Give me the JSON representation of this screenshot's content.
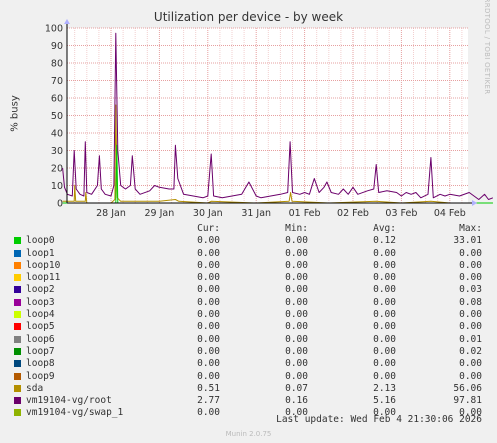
{
  "chart_data": {
    "type": "line",
    "title": "Utilization per device - by week",
    "ylabel": "% busy",
    "ylim": [
      0,
      100
    ],
    "yticks": [
      0,
      10,
      20,
      30,
      40,
      50,
      60,
      70,
      80,
      90,
      100
    ],
    "x_tick_labels": [
      "28 Jan",
      "29 Jan",
      "30 Jan",
      "31 Jan",
      "01 Feb",
      "02 Feb",
      "03 Feb",
      "04 Feb"
    ],
    "xlim": [
      "2026-01-27 00:00",
      "2026-02-04 21:30"
    ],
    "grid": true,
    "series": [
      {
        "name": "vm19104-vg/root",
        "points": [
          [
            0.0,
            20
          ],
          [
            0.04,
            9
          ],
          [
            0.1,
            5
          ],
          [
            0.2,
            4
          ],
          [
            0.24,
            30
          ],
          [
            0.28,
            8
          ],
          [
            0.36,
            5
          ],
          [
            0.44,
            4
          ],
          [
            0.47,
            35
          ],
          [
            0.5,
            6
          ],
          [
            0.6,
            5
          ],
          [
            0.72,
            10
          ],
          [
            0.76,
            27
          ],
          [
            0.8,
            8
          ],
          [
            0.88,
            5
          ],
          [
            1.0,
            4
          ],
          [
            1.06,
            10
          ],
          [
            1.1,
            97
          ],
          [
            1.14,
            30
          ],
          [
            1.2,
            10
          ],
          [
            1.3,
            8
          ],
          [
            1.4,
            10
          ],
          [
            1.44,
            27
          ],
          [
            1.5,
            8
          ],
          [
            1.6,
            5
          ],
          [
            1.8,
            7
          ],
          [
            1.9,
            10
          ],
          [
            2.0,
            9
          ],
          [
            2.2,
            8
          ],
          [
            2.3,
            8
          ],
          [
            2.33,
            33
          ],
          [
            2.38,
            14
          ],
          [
            2.5,
            5
          ],
          [
            2.7,
            4
          ],
          [
            2.9,
            3
          ],
          [
            3.0,
            4
          ],
          [
            3.07,
            28
          ],
          [
            3.12,
            4
          ],
          [
            3.3,
            3
          ],
          [
            3.5,
            4
          ],
          [
            3.7,
            5
          ],
          [
            3.85,
            12
          ],
          [
            4.0,
            4
          ],
          [
            4.1,
            3
          ],
          [
            4.3,
            4
          ],
          [
            4.5,
            5
          ],
          [
            4.65,
            6
          ],
          [
            4.7,
            35
          ],
          [
            4.75,
            6
          ],
          [
            4.9,
            5
          ],
          [
            5.0,
            6
          ],
          [
            5.1,
            5
          ],
          [
            5.2,
            14
          ],
          [
            5.3,
            6
          ],
          [
            5.4,
            9
          ],
          [
            5.46,
            12
          ],
          [
            5.55,
            6
          ],
          [
            5.7,
            5
          ],
          [
            5.8,
            8
          ],
          [
            5.9,
            5
          ],
          [
            6.0,
            9
          ],
          [
            6.1,
            5
          ],
          [
            6.3,
            7
          ],
          [
            6.43,
            8
          ],
          [
            6.48,
            22
          ],
          [
            6.53,
            6
          ],
          [
            6.7,
            7
          ],
          [
            6.9,
            6
          ],
          [
            7.0,
            4
          ],
          [
            7.1,
            6
          ],
          [
            7.2,
            5
          ],
          [
            7.3,
            6
          ],
          [
            7.4,
            3
          ],
          [
            7.55,
            5
          ],
          [
            7.61,
            26
          ],
          [
            7.66,
            3
          ],
          [
            7.8,
            5
          ],
          [
            7.9,
            4
          ],
          [
            8.0,
            5
          ],
          [
            8.2,
            4
          ],
          [
            8.4,
            6
          ],
          [
            8.6,
            2
          ],
          [
            8.72,
            5
          ],
          [
            8.8,
            2
          ],
          [
            8.89,
            3
          ]
        ]
      },
      {
        "name": "sda",
        "points": [
          [
            0.0,
            1
          ],
          [
            0.24,
            1
          ],
          [
            0.25,
            10
          ],
          [
            0.27,
            1
          ],
          [
            0.47,
            1
          ],
          [
            0.48,
            6
          ],
          [
            0.5,
            0
          ],
          [
            1.0,
            0
          ],
          [
            1.08,
            2
          ],
          [
            1.1,
            56
          ],
          [
            1.13,
            3
          ],
          [
            1.2,
            1
          ],
          [
            2.0,
            1
          ],
          [
            2.33,
            2
          ],
          [
            2.4,
            1
          ],
          [
            3.0,
            0
          ],
          [
            3.07,
            1
          ],
          [
            4.0,
            0
          ],
          [
            4.68,
            1
          ],
          [
            4.71,
            6
          ],
          [
            4.74,
            1
          ],
          [
            5.5,
            0
          ],
          [
            6.48,
            1
          ],
          [
            7.0,
            0
          ],
          [
            7.61,
            1
          ],
          [
            8.0,
            0
          ],
          [
            8.89,
            0
          ]
        ]
      },
      {
        "name": "loop0",
        "points": [
          [
            0.0,
            0
          ],
          [
            1.1,
            0
          ],
          [
            1.12,
            33
          ],
          [
            1.14,
            0
          ],
          [
            8.89,
            0
          ]
        ]
      }
    ]
  },
  "legend": {
    "headers": {
      "cur": "Cur:",
      "min": "Min:",
      "avg": "Avg:",
      "max": "Max:"
    },
    "rows": [
      {
        "name": "loop0",
        "color": "#00cc00",
        "cur": "0.00",
        "min": "0.00",
        "avg": "0.12",
        "max": "33.01"
      },
      {
        "name": "loop1",
        "color": "#0066b3",
        "cur": "0.00",
        "min": "0.00",
        "avg": "0.00",
        "max": "0.00"
      },
      {
        "name": "loop10",
        "color": "#ff8000",
        "cur": "0.00",
        "min": "0.00",
        "avg": "0.00",
        "max": "0.00"
      },
      {
        "name": "loop11",
        "color": "#ffcc00",
        "cur": "0.00",
        "min": "0.00",
        "avg": "0.00",
        "max": "0.00"
      },
      {
        "name": "loop2",
        "color": "#330099",
        "cur": "0.00",
        "min": "0.00",
        "avg": "0.00",
        "max": "0.03"
      },
      {
        "name": "loop3",
        "color": "#990099",
        "cur": "0.00",
        "min": "0.00",
        "avg": "0.00",
        "max": "0.08"
      },
      {
        "name": "loop4",
        "color": "#ccff00",
        "cur": "0.00",
        "min": "0.00",
        "avg": "0.00",
        "max": "0.00"
      },
      {
        "name": "loop5",
        "color": "#ff0000",
        "cur": "0.00",
        "min": "0.00",
        "avg": "0.00",
        "max": "0.00"
      },
      {
        "name": "loop6",
        "color": "#808080",
        "cur": "0.00",
        "min": "0.00",
        "avg": "0.00",
        "max": "0.01"
      },
      {
        "name": "loop7",
        "color": "#008f00",
        "cur": "0.00",
        "min": "0.00",
        "avg": "0.00",
        "max": "0.02"
      },
      {
        "name": "loop8",
        "color": "#00487d",
        "cur": "0.00",
        "min": "0.00",
        "avg": "0.00",
        "max": "0.00"
      },
      {
        "name": "loop9",
        "color": "#b35a00",
        "cur": "0.00",
        "min": "0.00",
        "avg": "0.00",
        "max": "0.00"
      },
      {
        "name": "sda",
        "color": "#b38f00",
        "cur": "0.51",
        "min": "0.07",
        "avg": "2.13",
        "max": "56.06"
      },
      {
        "name": "vm19104-vg/root",
        "color": "#6b006b",
        "cur": "2.77",
        "min": "0.16",
        "avg": "5.16",
        "max": "97.81"
      },
      {
        "name": "vm19104-vg/swap_1",
        "color": "#8fb300",
        "cur": "0.00",
        "min": "0.00",
        "avg": "0.00",
        "max": "0.00"
      }
    ]
  },
  "footer": {
    "last_update": "Last update: Wed Feb  4 21:30:06 2026",
    "version": "Munin 2.0.75"
  },
  "vendor": "RRDTOOL / TOBI OETIKER",
  "colors": {
    "background": "#f0f0f0",
    "plot_bg": "#ffffff",
    "grid": "#e8a0a0",
    "axis": "#000000"
  }
}
